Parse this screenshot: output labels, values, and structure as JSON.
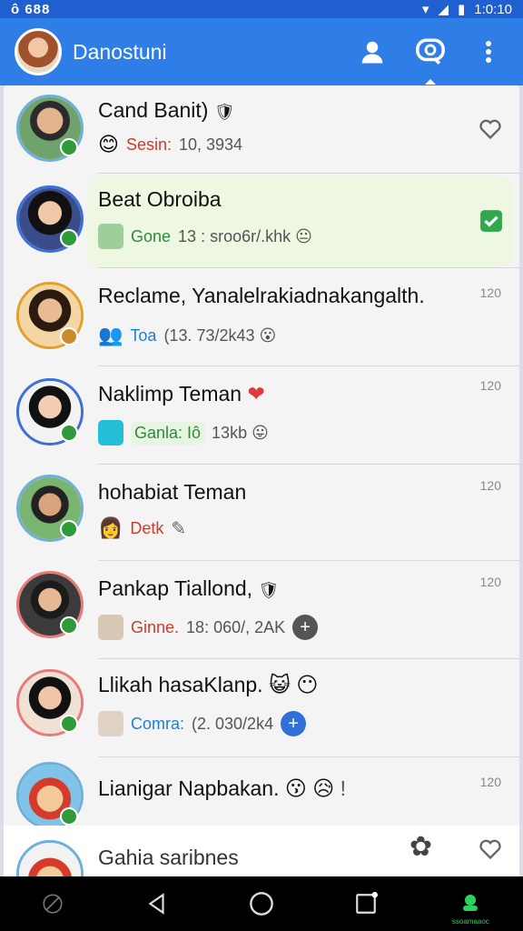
{
  "status_bar": {
    "left": "ô 688",
    "right": "1:0:10"
  },
  "app_bar": {
    "title": "Danostuni",
    "icons": [
      "contacts-icon",
      "chat-icon",
      "more-vert-icon"
    ]
  },
  "chats": [
    {
      "name": "Cand Banit)",
      "name_emoji": "🛡",
      "sub_emoji": "😊",
      "sub_label": "Sesin:",
      "sub_label_color": "#d03a2a",
      "sub_value": "10, 3934",
      "time": "",
      "right_icon": "heart-outline-icon",
      "avatar_ring": "#6fb0d9"
    },
    {
      "name": "Beat Obroiba",
      "name_emoji": "",
      "sub_emoji": "🙂",
      "sub_label": "Gone",
      "sub_label_color": "#2e8a3a",
      "sub_value": "13 : sroo6r/.khk 😐",
      "time": "",
      "right_icon": "check-box-icon",
      "avatar_ring": "#3d6fd8"
    },
    {
      "name": "Reclame, Yanalelrakiadnakangalth.",
      "name_emoji": "",
      "sub_emoji": "👥",
      "sub_label": "Toa",
      "sub_label_color": "#1f7fd6",
      "sub_value": "(13. 73/2k43 😮",
      "time": "120",
      "right_icon": "",
      "avatar_ring": "#e2a12b"
    },
    {
      "name": "Naklimp Teman",
      "name_emoji": "❤",
      "sub_emoji": "🟦",
      "sub_label": "Ganla: Iô",
      "sub_label_color": "#2e8a3a",
      "sub_value": "13kb 😛",
      "time": "120",
      "right_icon": "",
      "avatar_ring": "#3d6fd8"
    },
    {
      "name": "hohabiat Teman",
      "name_emoji": "",
      "sub_emoji": "👩",
      "sub_label": "Detk",
      "sub_label_color": "#d03a2a",
      "sub_value": "",
      "time": "120",
      "right_icon": "",
      "avatar_ring": "#6fb0d9"
    },
    {
      "name": "Pankap Tiallond,",
      "name_emoji": "🛡",
      "sub_emoji": "👤",
      "sub_label": "Ginne.",
      "sub_label_color": "#d03a2a",
      "sub_value": "18: 060/, 2AK",
      "time": "120",
      "right_icon": "",
      "avatar_ring": "#e77a7a"
    },
    {
      "name": "Llikah hasaKlanp.",
      "name_emoji": "😺",
      "sub_emoji": "👤",
      "sub_label": "Comra:",
      "sub_label_color": "#1f7fd6",
      "sub_value": "(2. 030/2k4",
      "time": "",
      "right_icon": "",
      "avatar_ring": "#e77a7a"
    },
    {
      "name": "Lianigar Napbakan.",
      "name_emoji": "😗",
      "sub_emoji": "",
      "sub_label": "",
      "sub_label_color": "#000",
      "sub_value": "",
      "time": "120",
      "right_icon": "",
      "avatar_ring": "#6fb0d9"
    },
    {
      "name": "Gahia saribnes",
      "name_emoji": "",
      "sub_emoji": "",
      "sub_label": "",
      "sub_label_color": "#000",
      "sub_value": "",
      "time": "",
      "right_icon": "heart-outline-icon",
      "avatar_ring": "#6fb0d9"
    }
  ],
  "nav_bar": {
    "items": [
      "back-icon",
      "home-icon",
      "recents-icon",
      "status-icon"
    ],
    "status_label": "ssoamaaoc"
  }
}
